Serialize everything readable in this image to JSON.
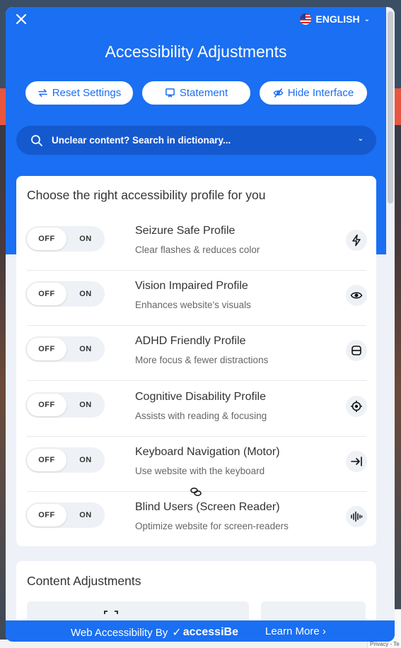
{
  "panel": {
    "language": "ENGLISH",
    "title": "Accessibility Adjustments",
    "buttons": {
      "reset": "Reset Settings",
      "statement": "Statement",
      "hide": "Hide Interface"
    },
    "search_placeholder": "Unclear content? Search in dictionary..."
  },
  "profiles": {
    "heading": "Choose the right accessibility profile for you",
    "off_label": "OFF",
    "on_label": "ON",
    "items": [
      {
        "title": "Seizure Safe Profile",
        "desc": "Clear flashes & reduces color",
        "icon": "lightning-icon"
      },
      {
        "title": "Vision Impaired Profile",
        "desc": "Enhances website's visuals",
        "icon": "eye-icon"
      },
      {
        "title": "ADHD Friendly Profile",
        "desc": "More focus & fewer distractions",
        "icon": "focus-box-icon"
      },
      {
        "title": "Cognitive Disability Profile",
        "desc": "Assists with reading & focusing",
        "icon": "target-icon"
      },
      {
        "title": "Keyboard Navigation (Motor)",
        "desc": "Use website with the keyboard",
        "icon": "arrow-to-bar-icon"
      },
      {
        "title": "Blind Users (Screen Reader)",
        "desc": "Optimize website for screen-readers",
        "icon": "sound-wave-icon"
      }
    ]
  },
  "content_adjustments": {
    "heading": "Content Adjustments"
  },
  "footer": {
    "by_text": "Web Accessibility By",
    "brand": "accessiBe",
    "learn_more": "Learn More"
  },
  "colors": {
    "primary": "#1a6ff2",
    "search_bg": "#1559cf",
    "panel_bg": "#eef1f7"
  }
}
